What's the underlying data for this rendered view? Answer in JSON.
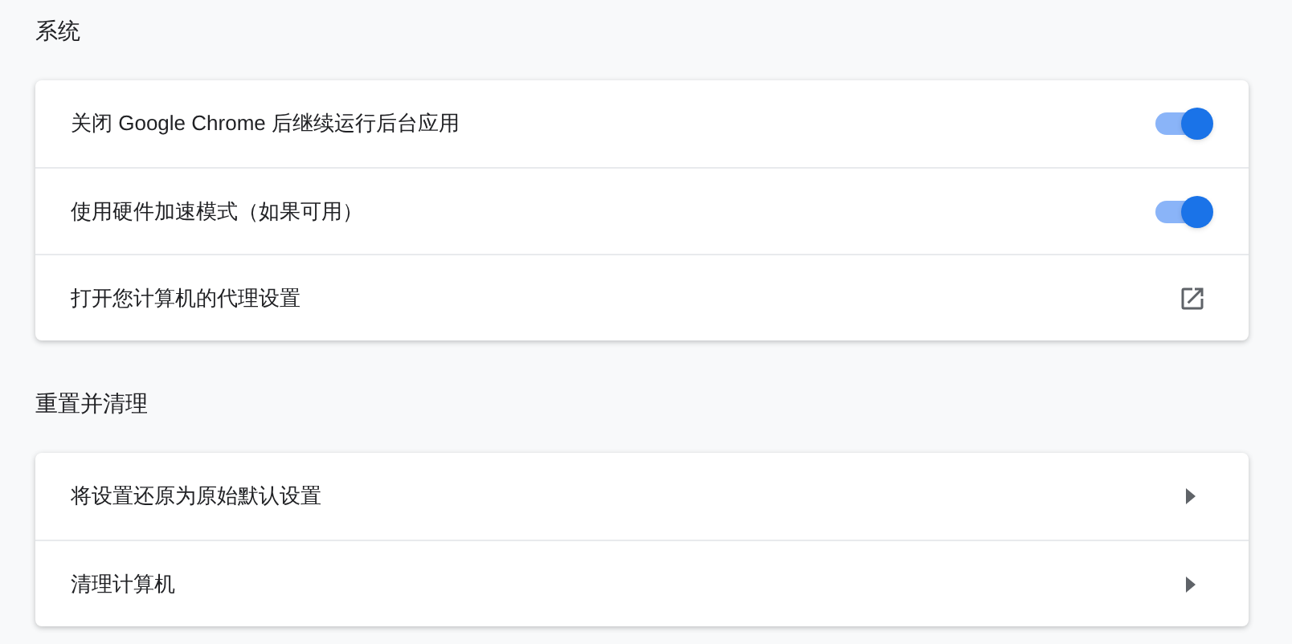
{
  "sections": [
    {
      "title": "系统",
      "rows": [
        {
          "kind": "toggle",
          "label": "关闭 Google Chrome 后继续运行后台应用",
          "on": true
        },
        {
          "kind": "toggle",
          "label": "使用硬件加速模式（如果可用）",
          "on": true
        },
        {
          "kind": "external",
          "label": "打开您计算机的代理设置"
        }
      ]
    },
    {
      "title": "重置并清理",
      "rows": [
        {
          "kind": "arrow",
          "label": "将设置还原为原始默认设置"
        },
        {
          "kind": "arrow",
          "label": "清理计算机"
        }
      ]
    }
  ]
}
